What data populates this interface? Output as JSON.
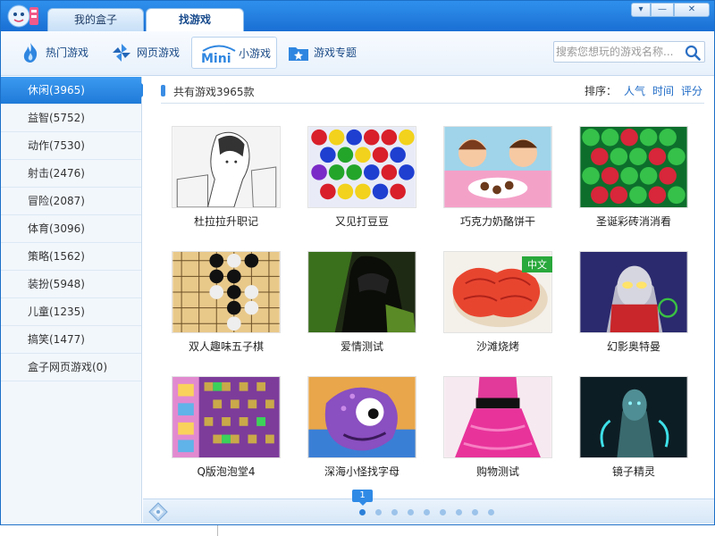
{
  "titlebar": {
    "tabs": [
      {
        "label": "我的盒子"
      },
      {
        "label": "找游戏"
      }
    ],
    "buttons": {
      "menu": "▾",
      "minimize": "—",
      "close": "✕"
    }
  },
  "toolbar": {
    "items": [
      {
        "label": "热门游戏",
        "icon": "fire-icon"
      },
      {
        "label": "网页游戏",
        "icon": "pinwheel-icon"
      },
      {
        "label": "小游戏",
        "icon": "mini-logo-icon",
        "logo_text": "Mini"
      },
      {
        "label": "游戏专题",
        "icon": "folder-star-icon"
      }
    ],
    "search": {
      "placeholder": "搜索您想玩的游戏名称..."
    }
  },
  "sidebar": {
    "items": [
      {
        "label": "休闲(3965)",
        "active": true
      },
      {
        "label": "益智(5752)"
      },
      {
        "label": "动作(7530)"
      },
      {
        "label": "射击(2476)"
      },
      {
        "label": "冒险(2087)"
      },
      {
        "label": "体育(3096)"
      },
      {
        "label": "策略(1562)"
      },
      {
        "label": "装扮(5948)"
      },
      {
        "label": "儿童(1235)"
      },
      {
        "label": "搞笑(1477)"
      },
      {
        "label": "盒子网页游戏(0)"
      }
    ]
  },
  "main": {
    "total_text": "共有游戏3965款",
    "sort_label": "排序：",
    "sort_options": [
      "人气",
      "时间",
      "评分"
    ],
    "games": [
      {
        "name": "杜拉拉升职记"
      },
      {
        "name": "又见打豆豆"
      },
      {
        "name": "巧克力奶酪饼干"
      },
      {
        "name": "圣诞彩砖消消看"
      },
      {
        "name": "双人趣味五子棋"
      },
      {
        "name": "爱情测试"
      },
      {
        "name": "沙滩烧烤",
        "badge": "中文"
      },
      {
        "name": "幻影奥特曼"
      },
      {
        "name": "Q版泡泡堂4"
      },
      {
        "name": "深海小怪找字母"
      },
      {
        "name": "购物测试"
      },
      {
        "name": "镜子精灵"
      }
    ]
  },
  "pager": {
    "current_page": "1",
    "page_count": 9
  },
  "colors": {
    "accent": "#2b7fd8",
    "titlebar": "#1a6fd4",
    "badge": "#29a83b"
  }
}
